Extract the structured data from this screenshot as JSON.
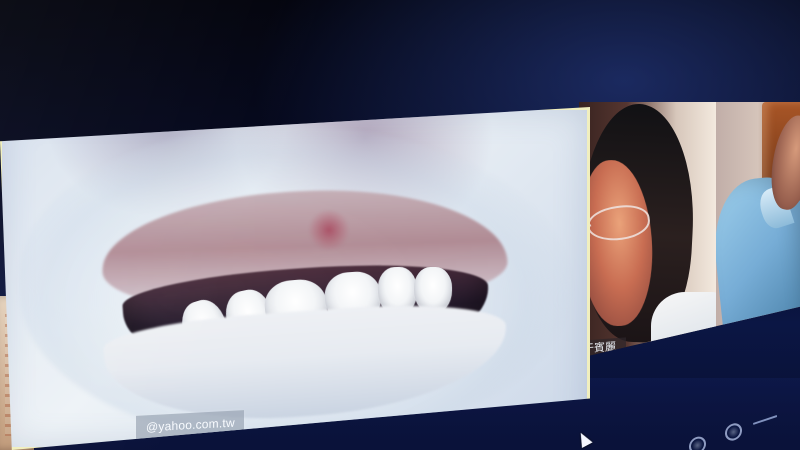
{
  "video_call": {
    "main_participant": {
      "email_fragment": "@yahoo.com.tw"
    },
    "secondary_participant": {
      "name_label": "于賓麗"
    }
  },
  "icons": {
    "cursor": "mouse-cursor-icon",
    "controls": [
      "round-control-icon",
      "round-control-icon",
      "volume-icon"
    ]
  },
  "colors": {
    "main_frame_border": "#f1efbe",
    "screen_dark": "#050714",
    "taskbar_blue": "#0b1644",
    "shirt_blue": "#77add6"
  }
}
